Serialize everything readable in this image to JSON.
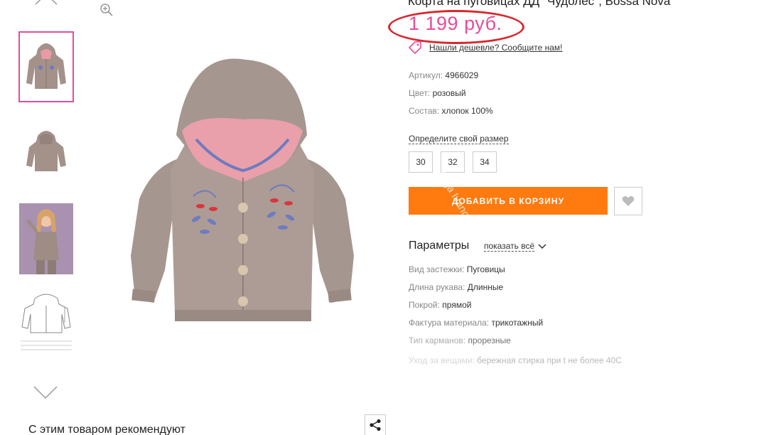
{
  "gallery": {
    "thumbnails": [
      {
        "name": "front",
        "active": true
      },
      {
        "name": "back",
        "active": false
      },
      {
        "name": "model-photo",
        "active": false
      },
      {
        "name": "size-chart",
        "active": false
      }
    ]
  },
  "product": {
    "title": "Кофта на пуговицах ДД \"Чудолес\", Bossa Nova",
    "price": "1 199 руб.",
    "cheaper_link": "Нашли дешевле? Сообщите нам!",
    "attributes": [
      {
        "key": "Артикул:",
        "value": "4966029"
      },
      {
        "key": "Цвет:",
        "value": "розовый"
      },
      {
        "key": "Состав:",
        "value": "хлопок 100%"
      }
    ],
    "size_title": "Определите свой размер",
    "sizes": [
      "30",
      "32",
      "34"
    ],
    "cart_button": "ДОБАВИТЬ В КОРЗИНУ",
    "watermark": "Olga Ivanov"
  },
  "params": {
    "title": "Параметры",
    "show_all": "показать всё",
    "items": [
      {
        "key": "Вид застежки:",
        "value": "Пуговицы"
      },
      {
        "key": "Длина рукава:",
        "value": "Длинные"
      },
      {
        "key": "Покрой:",
        "value": "прямой"
      },
      {
        "key": "Фактура материала:",
        "value": "трикотажный"
      },
      {
        "key": "Тип карманов:",
        "value": "прорезные"
      },
      {
        "key": "Уход за вещами:",
        "value": "бережная стирка при t не более 40С"
      }
    ]
  },
  "recommend": "С этим товаром рекомендуют",
  "colors": {
    "accent": "#e64c9a",
    "cart": "#ff7a0f",
    "annotation": "#d9262c"
  },
  "icons": [
    "chevron-up-icon",
    "chevron-down-icon",
    "zoom-in-icon",
    "tag-icon",
    "heart-icon",
    "share-icon"
  ]
}
